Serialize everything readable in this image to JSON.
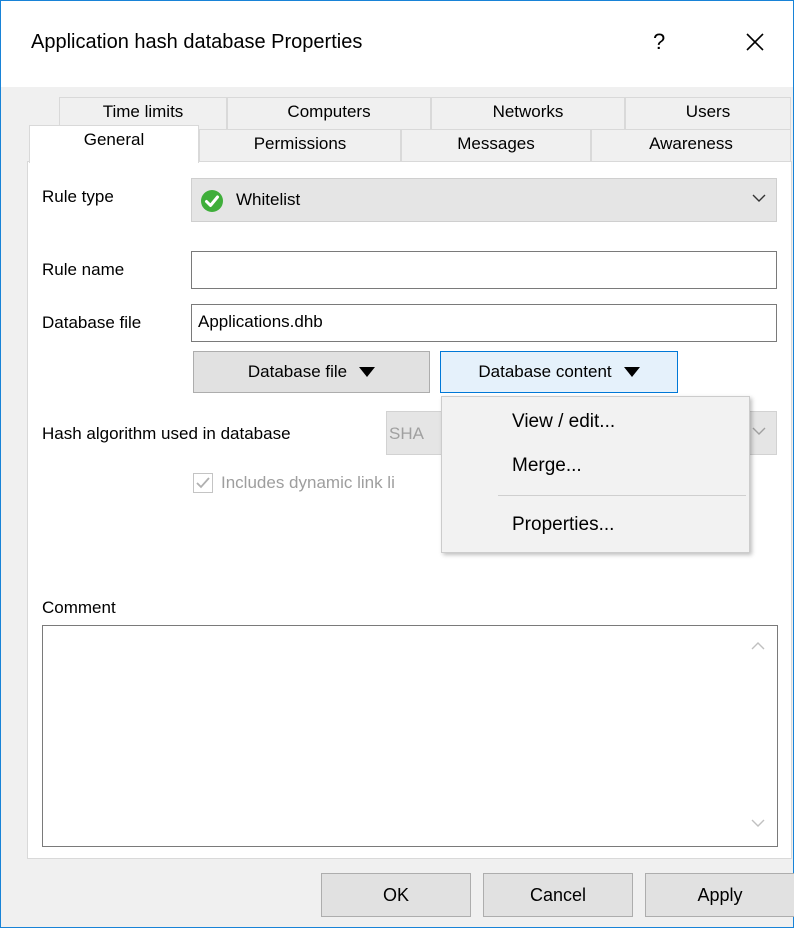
{
  "window": {
    "title": "Application hash database Properties",
    "help_label": "?",
    "accent_color": "#1883d7"
  },
  "tabs": {
    "back_row": [
      "Time limits",
      "Computers",
      "Networks",
      "Users"
    ],
    "front_row": [
      "General",
      "Permissions",
      "Messages",
      "Awareness"
    ],
    "selected": "General"
  },
  "general": {
    "rule_type_label": "Rule type",
    "rule_type_value": "Whitelist",
    "rule_type_icon": "green-check-circle-icon",
    "rule_name_label": "Rule name",
    "rule_name_value": "",
    "database_file_label": "Database file",
    "database_file_value": "Applications.dhb",
    "database_file_button": "Database file",
    "database_content_button": "Database content",
    "hash_algorithm_label": "Hash algorithm used in database",
    "hash_algorithm_value": "SHA",
    "dll_checkbox_label": "Includes dynamic link li",
    "dll_checkbox_checked": true,
    "comment_label": "Comment",
    "comment_value": ""
  },
  "context_menu": {
    "items": [
      "View / edit...",
      "Merge...",
      "Properties..."
    ]
  },
  "buttons": {
    "ok": "OK",
    "cancel": "Cancel",
    "apply": "Apply"
  }
}
